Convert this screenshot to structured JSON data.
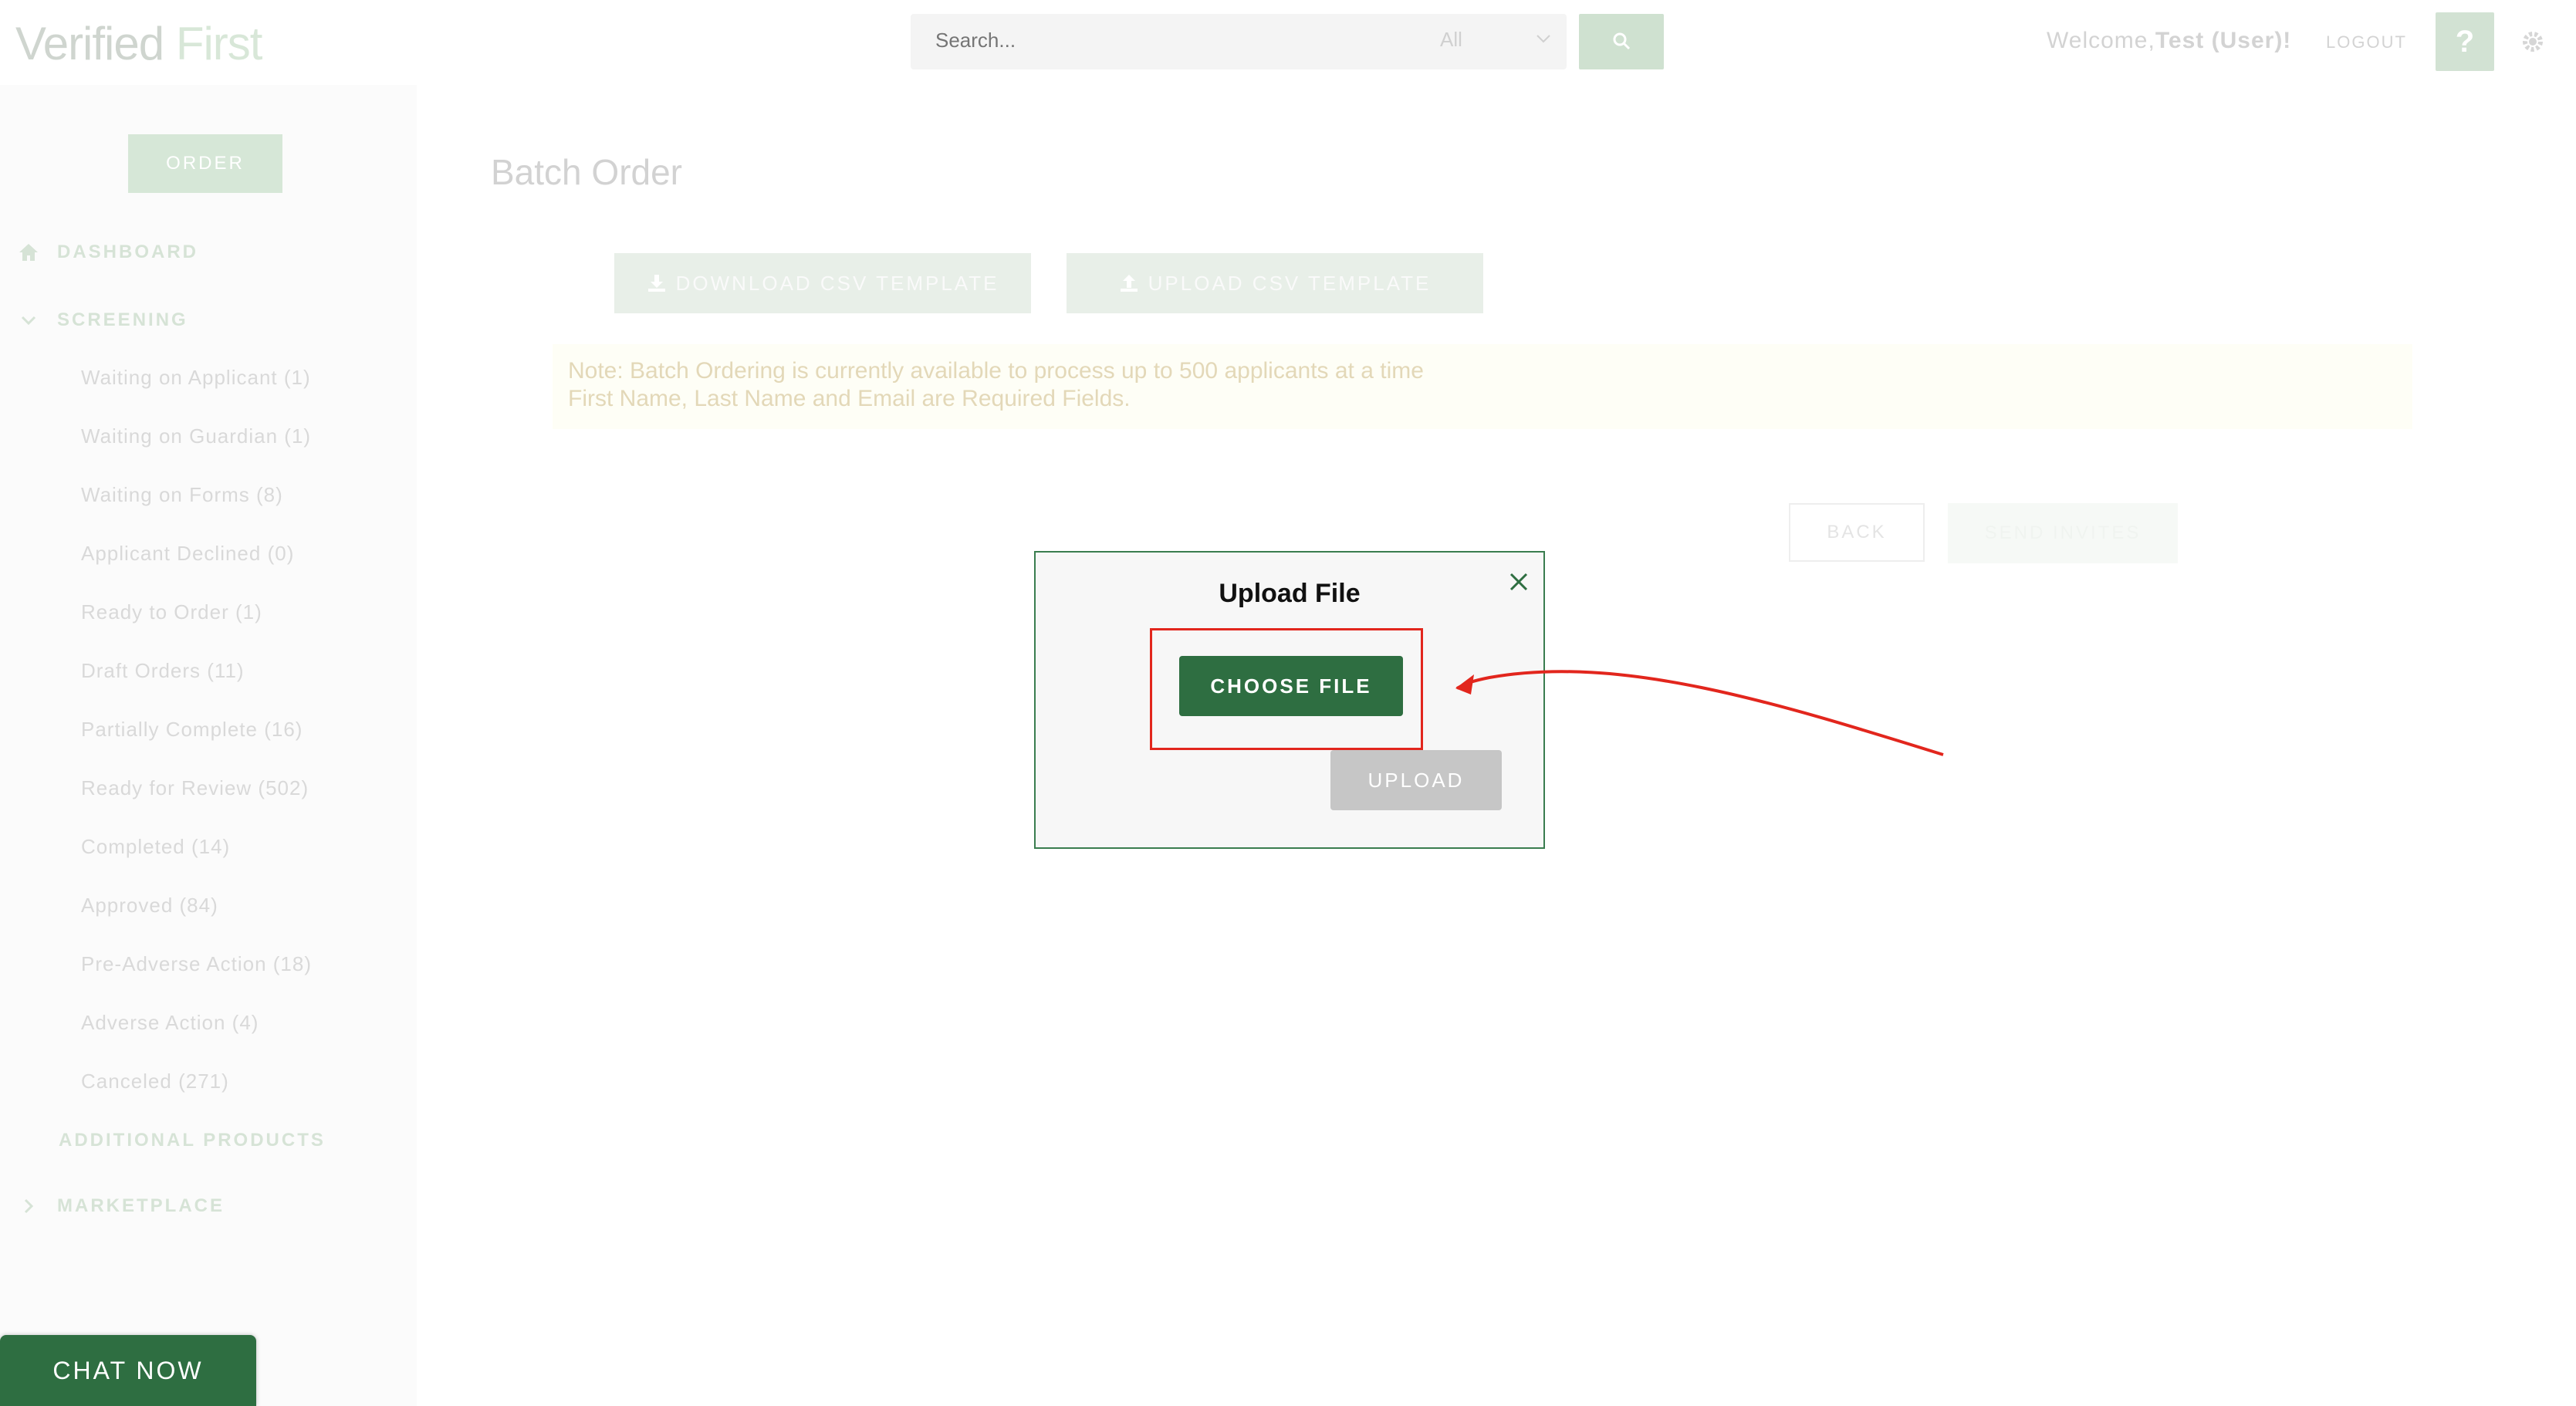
{
  "header": {
    "logo_left": "Verified",
    "logo_right": "First",
    "search_placeholder": "Search...",
    "search_filter": "All",
    "welcome_prefix": "Welcome,",
    "welcome_user": "Test (User)!",
    "logout": "LOGOUT",
    "help": "?"
  },
  "sidebar": {
    "order": "ORDER",
    "dashboard": "DASHBOARD",
    "screening": "SCREENING",
    "items": [
      "Waiting on Applicant (1)",
      "Waiting on Guardian (1)",
      "Waiting on Forms (8)",
      "Applicant Declined (0)",
      "Ready to Order (1)",
      "Draft Orders (11)",
      "Partially Complete (16)",
      "Ready for Review (502)",
      "Completed (14)",
      "Approved (84)",
      "Pre-Adverse Action (18)",
      "Adverse Action (4)",
      "Canceled (271)"
    ],
    "additional_products": "ADDITIONAL PRODUCTS",
    "marketplace": "MARKETPLACE"
  },
  "main": {
    "title": "Batch Order",
    "download_csv": "DOWNLOAD CSV TEMPLATE",
    "upload_csv": "UPLOAD CSV TEMPLATE",
    "note_line1": "Note: Batch Ordering is currently available to process up to 500 applicants at a time",
    "note_line2": "First Name, Last Name and Email are Required Fields.",
    "back": "BACK",
    "send_invites": "SEND INVITES"
  },
  "modal": {
    "title": "Upload File",
    "choose_file": "CHOOSE FILE",
    "upload": "UPLOAD"
  },
  "chat": {
    "label": "CHAT NOW"
  },
  "colors": {
    "brand_green": "#2e6e41",
    "highlight_red": "#e2261d",
    "disabled_gray": "#c6c6c6"
  }
}
